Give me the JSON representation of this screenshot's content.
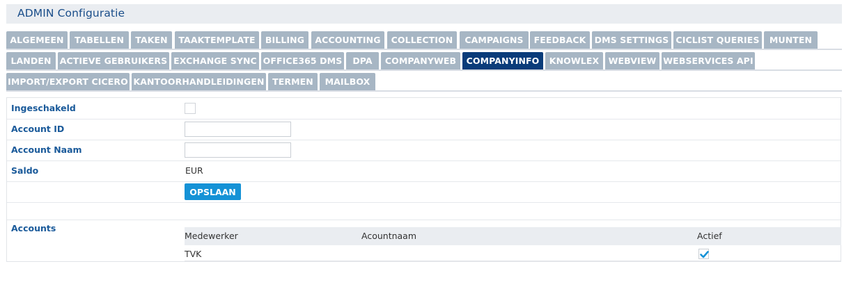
{
  "header": {
    "title": "ADMIN  Configuratie"
  },
  "tabs": {
    "row1": [
      "ALGEMEEN",
      "TABELLEN",
      "TAKEN",
      "TAAKTEMPLATE",
      "BILLING",
      "ACCOUNTING",
      "COLLECTION",
      "CAMPAIGNS",
      "FEEDBACK",
      "DMS SETTINGS",
      "CICLIST QUERIES",
      "MUNTEN"
    ],
    "row2": [
      "LANDEN",
      "ACTIEVE GEBRUIKERS",
      "EXCHANGE SYNC",
      "OFFICE365 DMS",
      "DPA",
      "COMPANYWEB",
      "COMPANYINFO",
      "KNOWLEX",
      "WEBVIEW",
      "WEBSERVICES API"
    ],
    "row3": [
      "IMPORT/EXPORT CICERO",
      "KANTOORHANDLEIDINGEN",
      "TERMEN",
      "MAILBOX"
    ],
    "active": "COMPANYINFO"
  },
  "form": {
    "ingeschakeld_label": "Ingeschakeld",
    "ingeschakeld_checked": false,
    "account_id_label": "Account ID",
    "account_id_value": "",
    "account_naam_label": "Account Naam",
    "account_naam_value": "",
    "saldo_label": "Saldo",
    "saldo_value": "EUR",
    "save_button": "OPSLAAN",
    "accounts_label": "Accounts"
  },
  "accounts_table": {
    "columns": [
      "Medewerker",
      "Acountnaam",
      "Actief"
    ],
    "rows": [
      {
        "medewerker": "TVK",
        "acountnaam": "",
        "actief": true
      }
    ]
  },
  "colors": {
    "tab_inactive": "#a7b6c4",
    "tab_active": "#0a3c7a",
    "label_blue": "#1a5a9a",
    "button_blue": "#1592d6",
    "check_blue": "#1592d6"
  }
}
